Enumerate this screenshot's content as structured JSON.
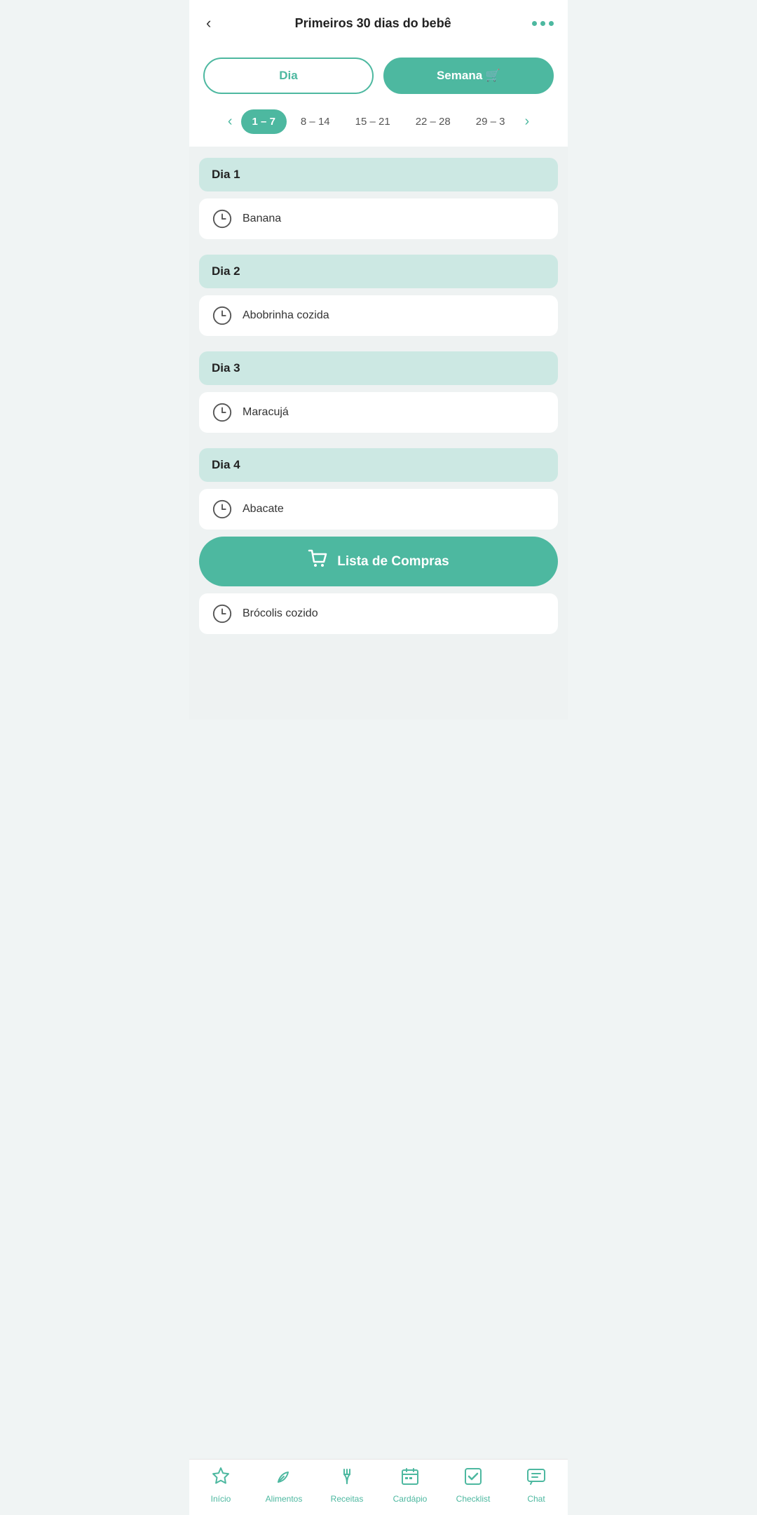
{
  "header": {
    "back_label": "‹",
    "title": "Primeiros 30 dias do bebê",
    "more_dots": [
      "●",
      "●",
      "●"
    ]
  },
  "toggle": {
    "dia_label": "Dia",
    "semana_label": "Semana 🛒",
    "active": "semana"
  },
  "weeks": [
    {
      "label": "1 – 7",
      "active": true
    },
    {
      "label": "8 – 14",
      "active": false
    },
    {
      "label": "15 – 21",
      "active": false
    },
    {
      "label": "22 – 28",
      "active": false
    },
    {
      "label": "29 – 3",
      "active": false
    }
  ],
  "days": [
    {
      "label": "Dia 1",
      "items": [
        {
          "food": "Banana"
        }
      ]
    },
    {
      "label": "Dia 2",
      "items": [
        {
          "food": "Abobrinha cozida"
        }
      ]
    },
    {
      "label": "Dia 3",
      "items": [
        {
          "food": "Maracujá"
        }
      ]
    },
    {
      "label": "Dia 4",
      "items": [
        {
          "food": "Abacate"
        },
        {
          "food": "Brócolis cozido"
        }
      ]
    }
  ],
  "compras_banner": {
    "label": "Lista de Compras"
  },
  "nav": [
    {
      "id": "inicio",
      "label": "Início",
      "icon": "star"
    },
    {
      "id": "alimentos",
      "label": "Alimentos",
      "icon": "leaf"
    },
    {
      "id": "receitas",
      "label": "Receitas",
      "icon": "fork"
    },
    {
      "id": "cardapio",
      "label": "Cardápio",
      "icon": "calendar"
    },
    {
      "id": "checklist",
      "label": "Checklist",
      "icon": "check"
    },
    {
      "id": "chat",
      "label": "Chat",
      "icon": "chat"
    }
  ]
}
